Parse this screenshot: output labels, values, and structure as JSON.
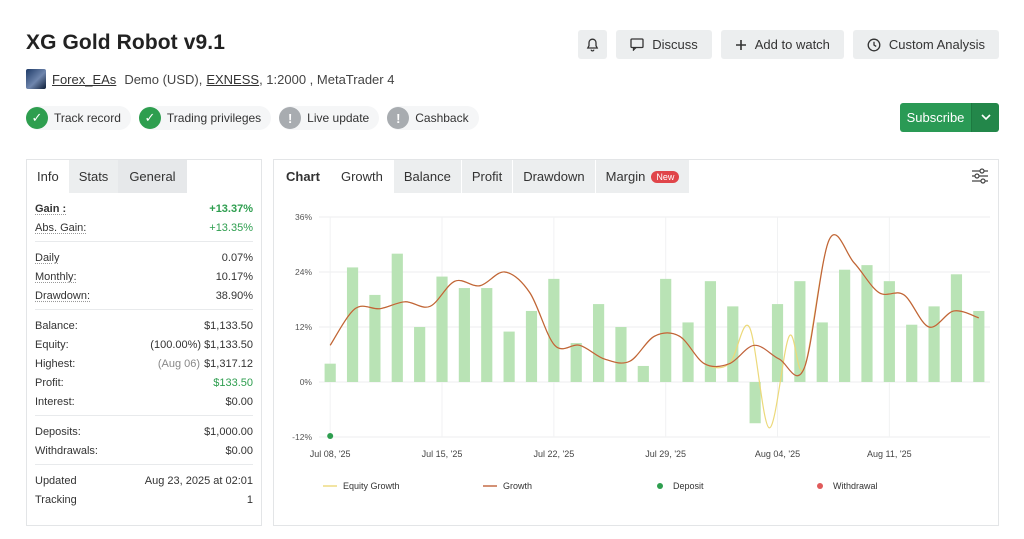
{
  "header": {
    "title": "XG Gold Robot v9.1",
    "discuss": "Discuss",
    "add_watch": "Add to watch",
    "custom_analysis": "Custom Analysis"
  },
  "meta": {
    "author": "Forex_EAs",
    "account": "Demo (USD),",
    "broker": "EXNESS",
    "rest": ", 1:2000 , MetaTrader 4"
  },
  "badges": [
    {
      "label": "Track record",
      "state": "ok"
    },
    {
      "label": "Trading privileges",
      "state": "ok"
    },
    {
      "label": "Live update",
      "state": "warn"
    },
    {
      "label": "Cashback",
      "state": "warn"
    }
  ],
  "subscribe": "Subscribe",
  "left_tabs": [
    "Info",
    "Stats",
    "General"
  ],
  "stats": {
    "gain_label": "Gain :",
    "gain": "+13.37%",
    "abs_gain_label": "Abs. Gain:",
    "abs_gain": "+13.35%",
    "daily_label": "Daily",
    "daily": "0.07%",
    "monthly_label": "Monthly:",
    "monthly": "10.17%",
    "drawdown_label": "Drawdown:",
    "drawdown": "38.90%",
    "balance_label": "Balance:",
    "balance": "$1,133.50",
    "equity_label": "Equity:",
    "equity_pct": "(100.00%)",
    "equity": "$1,133.50",
    "highest_label": "Highest:",
    "highest_date": "(Aug 06)",
    "highest": "$1,317.12",
    "profit_label": "Profit:",
    "profit": "$133.50",
    "interest_label": "Interest:",
    "interest": "$0.00",
    "deposits_label": "Deposits:",
    "deposits": "$1,000.00",
    "withdrawals_label": "Withdrawals:",
    "withdrawals": "$0.00",
    "updated_label": "Updated",
    "updated": "Aug 23, 2025 at 02:01",
    "tracking_label": "Tracking",
    "tracking": "1"
  },
  "chart_tabs": {
    "label": "Chart",
    "growth": "Growth",
    "balance": "Balance",
    "profit": "Profit",
    "drawdown": "Drawdown",
    "margin": "Margin",
    "new_badge": "New"
  },
  "colors": {
    "bar": "#b9e3b5",
    "growth_line": "#c0623a",
    "equity_line": "#ecd97a",
    "deposit": "#2e9e4f",
    "withdrawal": "#e05a5a",
    "subscribe": "#2a9a55"
  },
  "chart_data": {
    "type": "bar",
    "y_ticks": [
      "36%",
      "24%",
      "12%",
      "0%",
      "-12%"
    ],
    "ylim": [
      -12,
      36
    ],
    "x_tick_labels": [
      "Jul 08, '25",
      "Jul 15, '25",
      "Jul 22, '25",
      "Jul 29, '25",
      "Aug 04, '25",
      "Aug 11, '25"
    ],
    "bars": [
      4,
      25,
      19,
      28,
      12,
      23,
      20.5,
      20.5,
      11,
      15.5,
      22.5,
      8.5,
      17,
      12,
      3.5,
      22.5,
      13,
      22,
      16.5,
      -9,
      17,
      22,
      13,
      24.5,
      25.5,
      22,
      12.5,
      16.5,
      23.5,
      15.5
    ],
    "growth": [
      8,
      16,
      16,
      17.5,
      16.5,
      22,
      21,
      24,
      19.5,
      8,
      8,
      5,
      4.5,
      10,
      10,
      4,
      4,
      8,
      5,
      3,
      31,
      26,
      19.5,
      19,
      12,
      15.5,
      14
    ],
    "equity_extra": [
      12,
      -10,
      10
    ],
    "legend": [
      {
        "name": "Equity Growth",
        "kind": "line"
      },
      {
        "name": "Growth",
        "kind": "line"
      },
      {
        "name": "Deposit",
        "kind": "dot"
      },
      {
        "name": "Withdrawal",
        "kind": "dot"
      }
    ]
  }
}
